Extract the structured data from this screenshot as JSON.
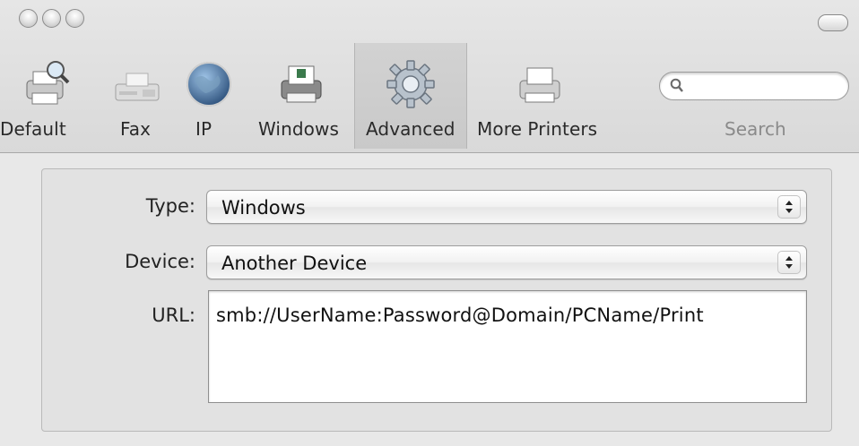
{
  "window": {
    "controls": [
      "close",
      "minimize",
      "zoom",
      "toolbar-toggle"
    ]
  },
  "toolbar": {
    "items": [
      {
        "label": "Default",
        "icon": "printer-magnifier-icon"
      },
      {
        "label": "Fax",
        "icon": "fax-icon"
      },
      {
        "label": "IP",
        "icon": "globe-icon"
      },
      {
        "label": "Windows",
        "icon": "windows-printer-icon"
      },
      {
        "label": "Advanced",
        "icon": "gear-icon",
        "selected": true
      },
      {
        "label": "More Printers",
        "icon": "printer-icon"
      }
    ],
    "search": {
      "label": "Search",
      "placeholder": ""
    }
  },
  "form": {
    "type_label": "Type:",
    "type_value": "Windows",
    "device_label": "Device:",
    "device_value": "Another Device",
    "url_label": "URL:",
    "url_value": "smb://UserName:Password@Domain/PCName/Print"
  },
  "colors": {
    "window_bg": "#e6e6e6",
    "panel_bg": "#e2e2e2",
    "selected_tool_bg": "#cdcdcd",
    "label_text": "#2a2a2a",
    "search_text": "#8a8a8a"
  }
}
